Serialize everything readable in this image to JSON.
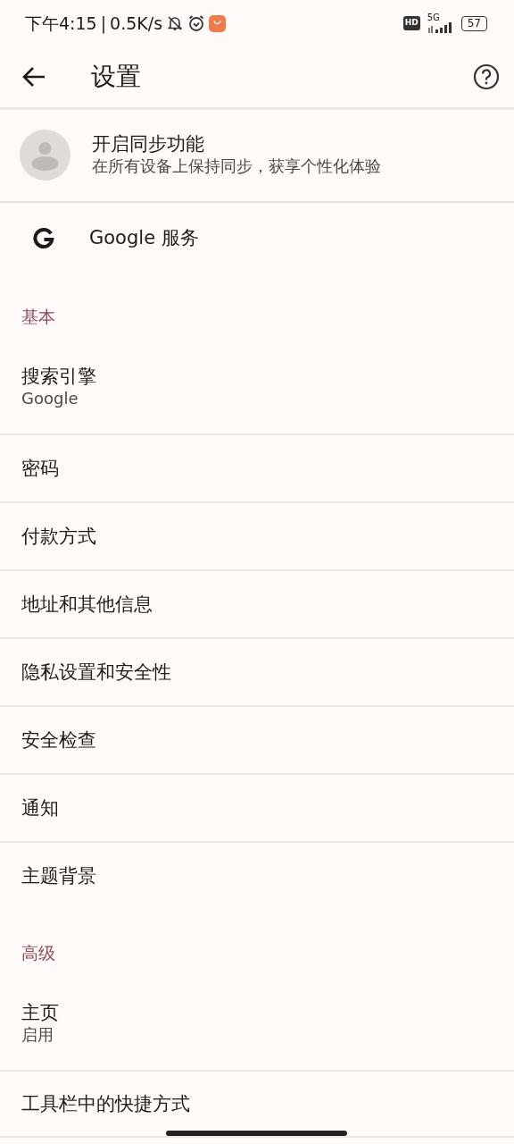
{
  "status_bar": {
    "time": "下午4:15",
    "separator": "|",
    "speed": "0.5K/s",
    "hd": "HD",
    "network": "5G",
    "battery": "57"
  },
  "toolbar": {
    "title": "设置"
  },
  "sync": {
    "title": "开启同步功能",
    "subtitle": "在所有设备上保持同步，获享个性化体验"
  },
  "google_services": {
    "label": "Google 服务"
  },
  "sections": [
    {
      "header": "基本",
      "items": [
        {
          "title": "搜索引擎",
          "subtitle": "Google"
        },
        {
          "title": "密码"
        },
        {
          "title": "付款方式"
        },
        {
          "title": "地址和其他信息"
        },
        {
          "title": "隐私设置和安全性"
        },
        {
          "title": "安全检查"
        },
        {
          "title": "通知"
        },
        {
          "title": "主题背景"
        }
      ]
    },
    {
      "header": "高级",
      "items": [
        {
          "title": "主页",
          "subtitle": "启用"
        },
        {
          "title": "工具栏中的快捷方式"
        }
      ]
    }
  ]
}
